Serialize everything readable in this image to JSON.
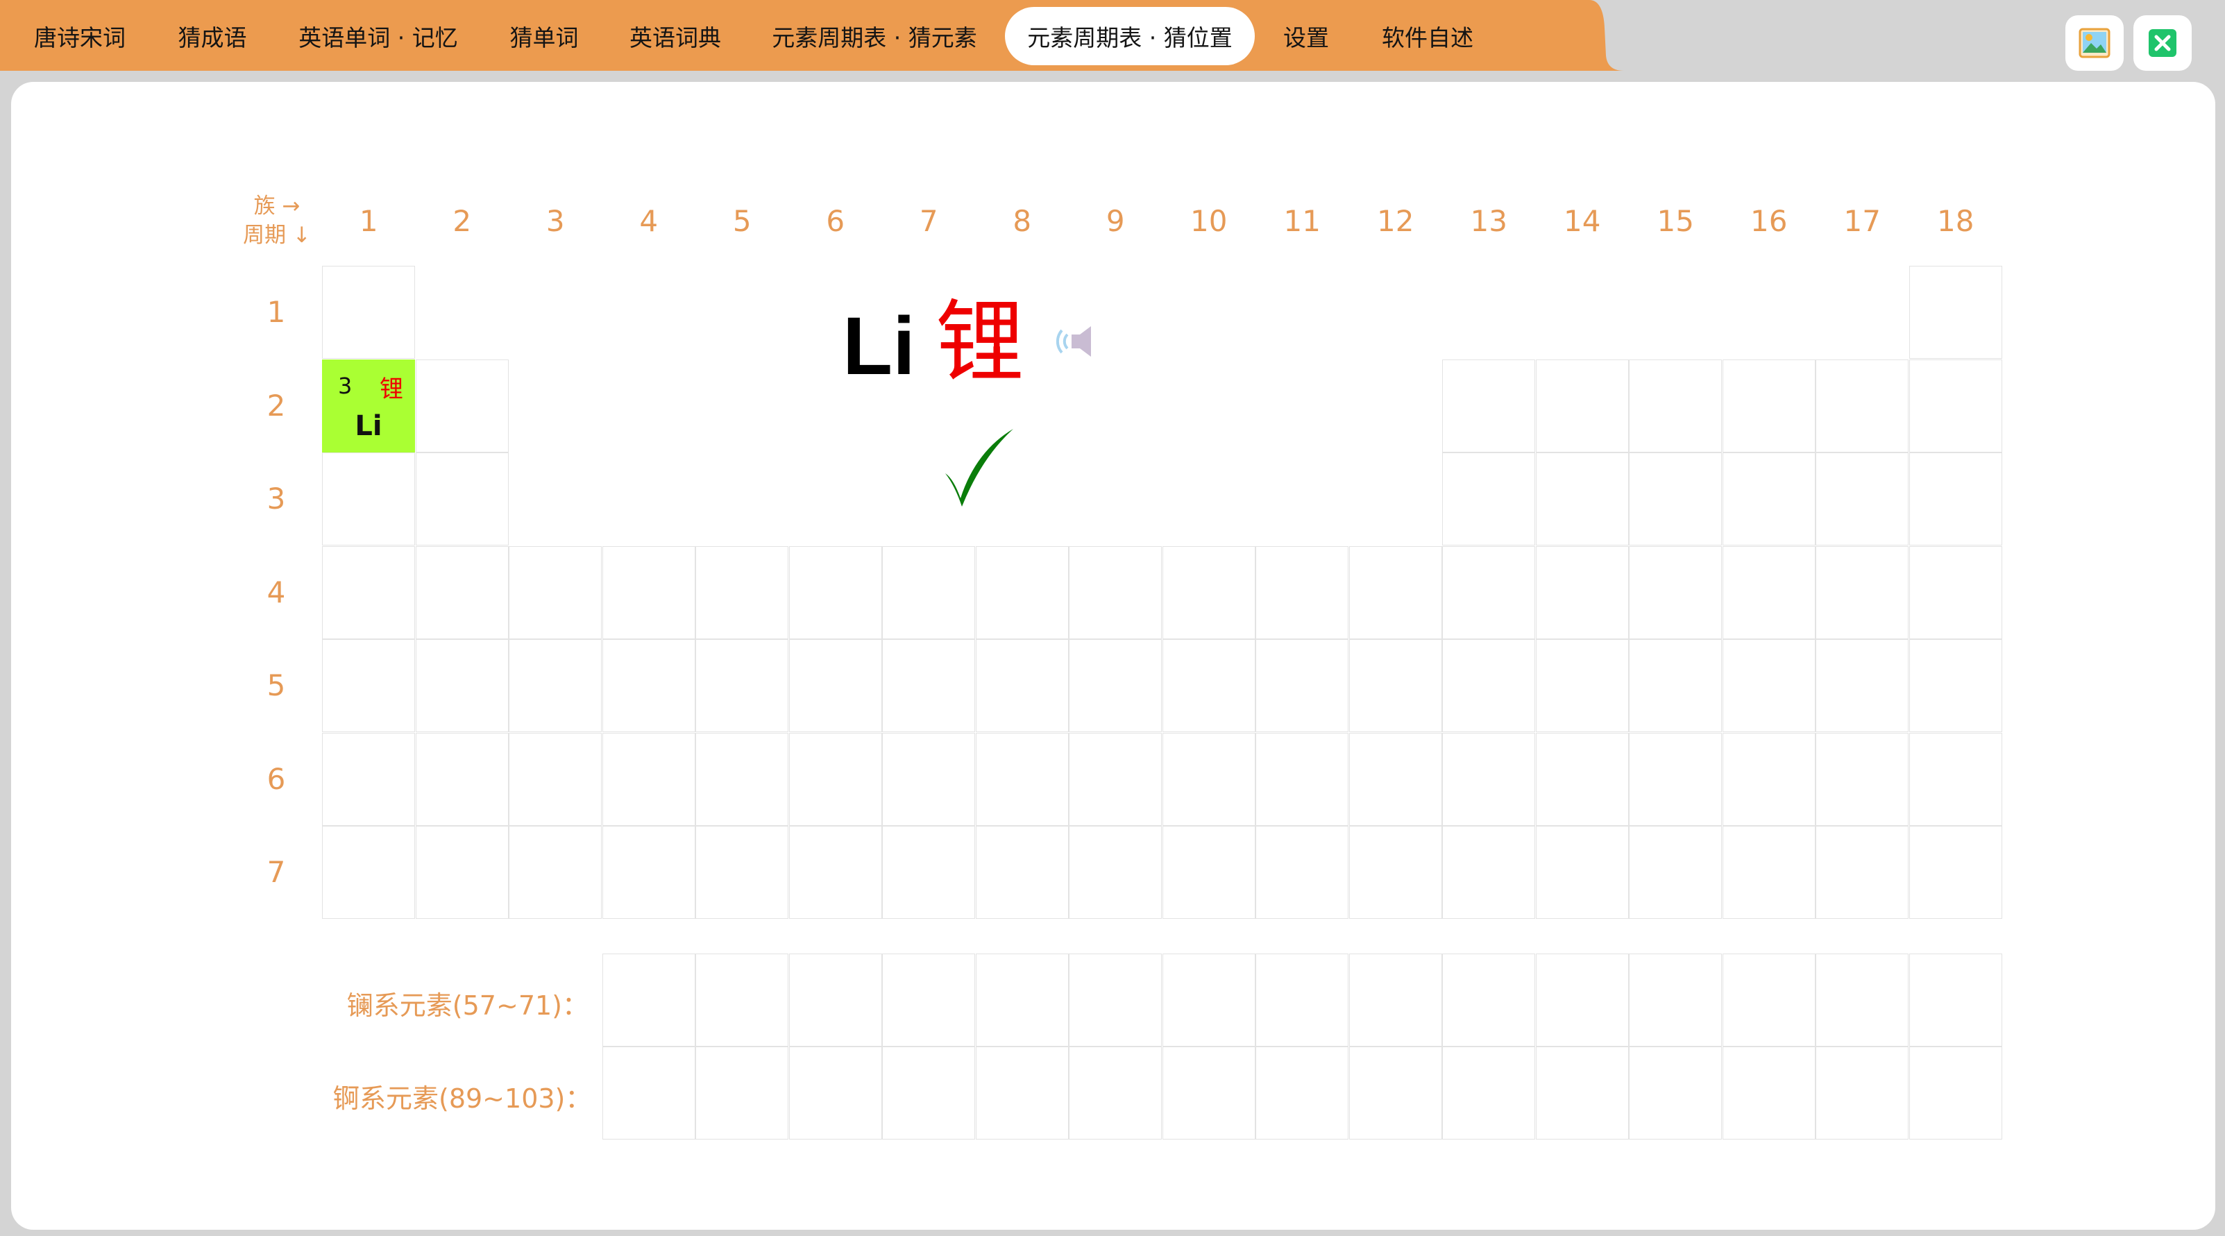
{
  "tabs": [
    {
      "label": "唐诗宋词",
      "name": "tab-poems"
    },
    {
      "label": "猜成语",
      "name": "tab-idioms"
    },
    {
      "label": "英语单词 · 记忆",
      "name": "tab-english-memory"
    },
    {
      "label": "猜单词",
      "name": "tab-guess-word"
    },
    {
      "label": "英语词典",
      "name": "tab-dictionary"
    },
    {
      "label": "元素周期表 · 猜元素",
      "name": "tab-guess-element"
    },
    {
      "label": "元素周期表 · 猜位置",
      "name": "tab-guess-position",
      "active": true
    },
    {
      "label": "设置",
      "name": "tab-settings"
    },
    {
      "label": "软件自述",
      "name": "tab-about"
    }
  ],
  "window_buttons": {
    "wallpaper_icon": "picture-icon",
    "close_icon": "close-icon",
    "close_color": "#1fc46b"
  },
  "table": {
    "corner_group": "族 →",
    "corner_period": "周期 ↓",
    "groups": [
      "1",
      "2",
      "3",
      "4",
      "5",
      "6",
      "7",
      "8",
      "9",
      "10",
      "11",
      "12",
      "13",
      "14",
      "15",
      "16",
      "17",
      "18"
    ],
    "periods": [
      "1",
      "2",
      "3",
      "4",
      "5",
      "6",
      "7"
    ],
    "lanthanide_label": "镧系元素(57~71)：",
    "actinide_label": "锕系元素(89~103)："
  },
  "placed": {
    "number": "3",
    "chinese": "锂",
    "symbol": "Li",
    "highlight_color": "#aaff33"
  },
  "question": {
    "symbol": "Li",
    "chinese": "锂",
    "speaker_icon": "speaker-icon",
    "result_icon": "checkmark-icon",
    "result_color": "#0a7d0a"
  },
  "colors": {
    "tab_bar": "#ec9b4f",
    "header_text": "#e69a56",
    "background": "#d4d4d4"
  }
}
